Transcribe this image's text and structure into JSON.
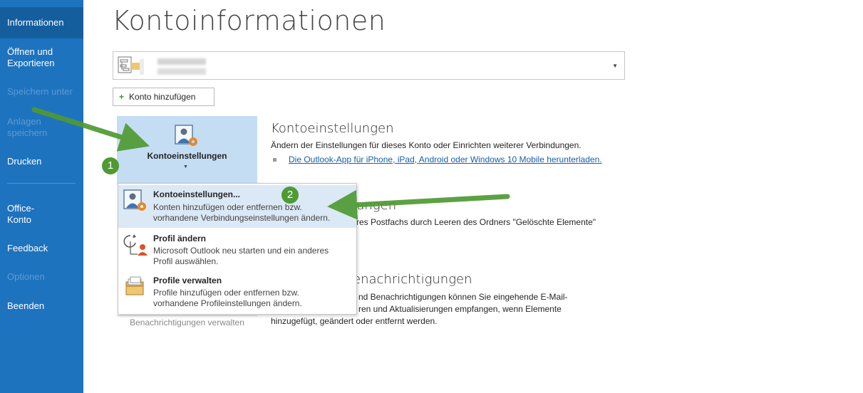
{
  "sidebar": {
    "items": [
      {
        "label": "Informationen"
      },
      {
        "label": "Öffnen und Exportieren"
      },
      {
        "label": "Speichern unter"
      },
      {
        "label": "Anlagen speichern"
      },
      {
        "label": "Drucken"
      },
      {
        "label": "Office-Konto"
      },
      {
        "label": "Feedback"
      },
      {
        "label": "Optionen"
      },
      {
        "label": "Beenden"
      }
    ]
  },
  "page": {
    "title": "Kontoinformationen"
  },
  "account_selector": {
    "selected": ""
  },
  "add_account": {
    "label": "Konto hinzufügen"
  },
  "account_settings_tile": {
    "label": "Kontoeinstellungen"
  },
  "section_account_settings": {
    "title": "Kontoeinstellungen",
    "description": "Ändern der Einstellungen für dieses Konto oder Einrichten weiterer Verbindungen.",
    "link": "Die Outlook-App für iPhone, iPad, Android oder Windows 10 Mobile herunterladen."
  },
  "section_mailbox": {
    "title_partial": "ungen",
    "text_partial": "res Postfachs durch Leeren des Ordners \"Gelöschte Elemente\""
  },
  "section_notifications": {
    "title_partial": "enachrichtigungen",
    "line1": "nd Benachrichtigungen können Sie eingehende E-Mail-",
    "line2": "ren und Aktualisierungen empfangen, wenn Elemente",
    "line3": "hinzugefügt, geändert oder entfernt werden.",
    "button": "Benachrichtigungen verwalten"
  },
  "dropdown": {
    "items": [
      {
        "title": "Kontoeinstellungen...",
        "desc1": "Konten hinzufügen oder entfernen bzw.",
        "desc2": "vorhandene Verbindungseinstellungen ändern."
      },
      {
        "title": "Profil ändern",
        "desc1": "Microsoft Outlook neu starten und ein anderes",
        "desc2": "Profil auswählen."
      },
      {
        "title": "Profile verwalten",
        "desc1": "Profile hinzufügen oder entfernen bzw.",
        "desc2": "vorhandene Profileinstellungen ändern."
      }
    ]
  },
  "annotations": {
    "badge1": "1",
    "badge2": "2"
  },
  "colors": {
    "sidebar": "#1e73bf",
    "accent_green": "#4f9a33",
    "tile_bg": "#c5ddf3",
    "link": "#1a5ea8"
  }
}
